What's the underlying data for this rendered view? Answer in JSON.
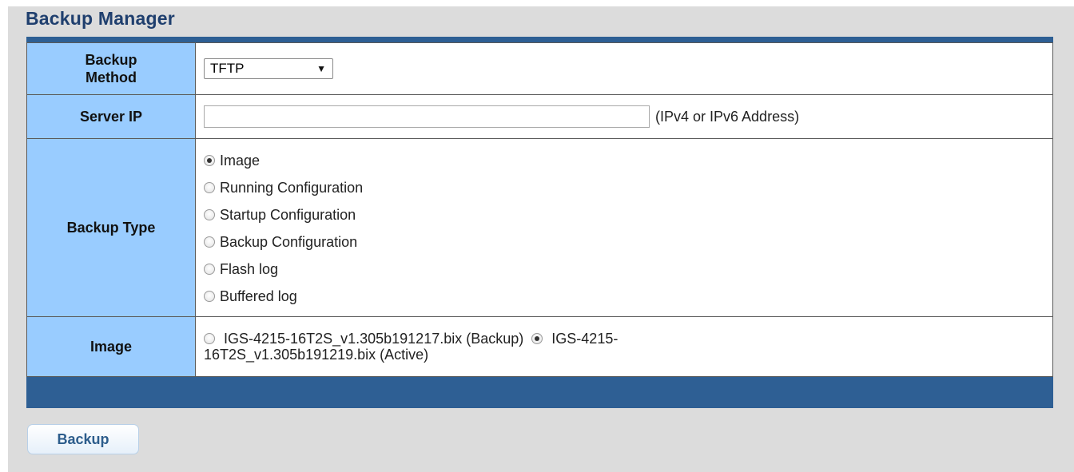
{
  "page": {
    "title": "Backup Manager"
  },
  "rows": {
    "method": {
      "label": "Backup Method",
      "label_line1": "Backup",
      "label_line2": "Method",
      "selected": "TFTP"
    },
    "server_ip": {
      "label": "Server IP",
      "value": "",
      "hint": "(IPv4 or IPv6 Address)"
    },
    "backup_type": {
      "label": "Backup Type",
      "options": [
        {
          "label": "Image",
          "checked": true
        },
        {
          "label": "Running Configuration",
          "checked": false
        },
        {
          "label": "Startup Configuration",
          "checked": false
        },
        {
          "label": "Backup Configuration",
          "checked": false
        },
        {
          "label": "Flash log",
          "checked": false
        },
        {
          "label": "Buffered log",
          "checked": false
        }
      ]
    },
    "image": {
      "label": "Image",
      "options": [
        {
          "label": "IGS-4215-16T2S_v1.305b191217.bix (Backup)",
          "checked": false
        },
        {
          "label_part1": "IGS-4215-",
          "label_part2": "16T2S_v1.305b191219.bix (Active)",
          "checked": true
        }
      ]
    }
  },
  "actions": {
    "backup_label": "Backup"
  },
  "colors": {
    "title": "#1f3f6e",
    "frame": "#2e5f94",
    "label_cell": "#99ccff",
    "panel": "#dcdcdc"
  }
}
